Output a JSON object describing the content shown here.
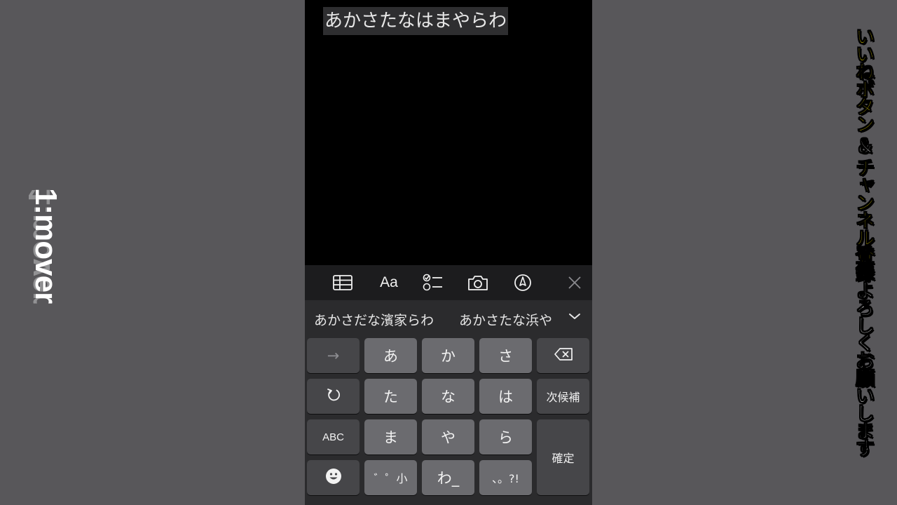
{
  "logo": {
    "text": "1:mover"
  },
  "note": {
    "text": "あかさたなはまやらわ"
  },
  "toolbar": {
    "items": [
      {
        "name": "table-icon"
      },
      {
        "name": "text-format",
        "label": "Aa"
      },
      {
        "name": "checklist-icon"
      },
      {
        "name": "camera-icon"
      },
      {
        "name": "markup-pen-icon"
      },
      {
        "name": "close-icon"
      }
    ]
  },
  "keyboard": {
    "candidates": [
      "あかさだな濱家らわ",
      "あかさたな浜や"
    ],
    "candidates_expand_icon": "chevron-down-icon",
    "keys": {
      "arrow": "→",
      "a": "あ",
      "ka": "か",
      "sa": "さ",
      "undo_icon": "undo-icon",
      "ta": "た",
      "na": "な",
      "ha": "は",
      "next": "次候補",
      "abc": "ABC",
      "ma": "ま",
      "ya": "や",
      "ra": "ら",
      "confirm": "確定",
      "emoji_icon": "emoji-icon",
      "dakuten": "゛゜小",
      "wa": "わ_",
      "punct": "、。?!",
      "delete_icon": "delete-icon"
    }
  },
  "side_caption": {
    "part1": "いいねボタン",
    "amp": "＆",
    "part2": "チャンネル登録",
    "part3": "よろしくお願いします"
  },
  "colors": {
    "background": "#58575a",
    "screen": "#000000",
    "keyboard": "#2b2b2d",
    "key": "#6b6b6f",
    "function_key": "#464649",
    "caption_yellow": "#ffe900",
    "cursor": "#e0a030"
  }
}
